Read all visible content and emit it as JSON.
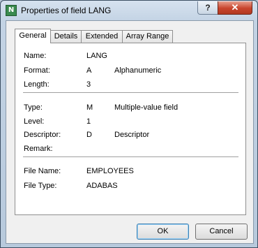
{
  "window": {
    "title": "Properties of field LANG",
    "help_label": "?",
    "close_label": "✕",
    "app_icon_label": "N"
  },
  "tabs": [
    {
      "label": "General",
      "active": true
    },
    {
      "label": "Details",
      "active": false
    },
    {
      "label": "Extended",
      "active": false
    },
    {
      "label": "Array Range",
      "active": false
    }
  ],
  "general": {
    "name": {
      "label": "Name:",
      "value": "LANG"
    },
    "format": {
      "label": "Format:",
      "value": "A",
      "description": "Alphanumeric"
    },
    "length": {
      "label": "Length:",
      "value": "3"
    },
    "type": {
      "label": "Type:",
      "value": "M",
      "description": "Multiple-value field"
    },
    "level": {
      "label": "Level:",
      "value": "1"
    },
    "descriptor": {
      "label": "Descriptor:",
      "value": "D",
      "description": "Descriptor"
    },
    "remark": {
      "label": "Remark:",
      "value": ""
    },
    "file_name": {
      "label": "File Name:",
      "value": "EMPLOYEES"
    },
    "file_type": {
      "label": "File Type:",
      "value": "ADABAS"
    }
  },
  "buttons": {
    "ok": "OK",
    "cancel": "Cancel"
  }
}
